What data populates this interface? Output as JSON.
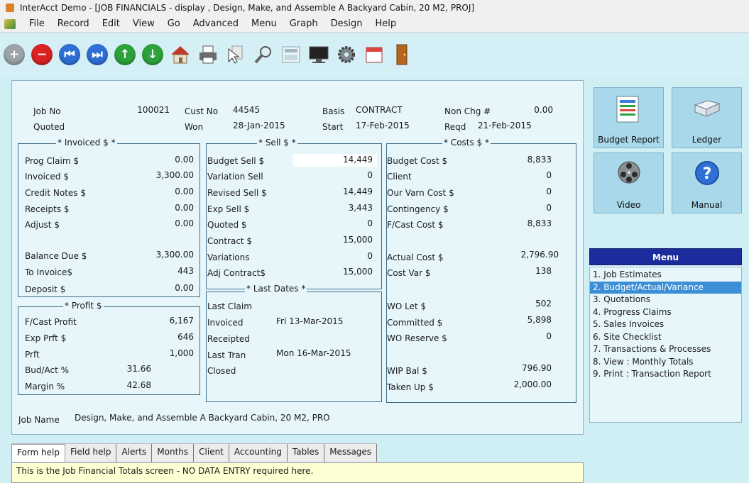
{
  "window": {
    "title": "InterAcct Demo - [JOB FINANCIALS - display , Design, Make, and Assemble A Backyard Cabin, 20 M2, PROJ]"
  },
  "menubar": [
    "File",
    "Record",
    "Edit",
    "View",
    "Go",
    "Advanced",
    "Menu",
    "Graph",
    "Design",
    "Help"
  ],
  "header": {
    "job_no_label": "Job No",
    "job_no": "100021",
    "quoted_label": "Quoted",
    "cust_no_label": "Cust No",
    "cust_no": "44545",
    "won_label": "Won",
    "won": "28-Jan-2015",
    "basis_label": "Basis",
    "basis": "CONTRACT",
    "start_label": "Start",
    "start": "17-Feb-2015",
    "non_chg_label": "Non Chg #",
    "non_chg": "0.00",
    "reqd_label": "Reqd",
    "reqd": "21-Feb-2015"
  },
  "invoiced": {
    "heading": "* Invoiced $ *",
    "prog_claim_label": "Prog Claim $",
    "prog_claim": "0.00",
    "invoiced_label": "Invoiced $",
    "invoiced": "3,300.00",
    "credit_notes_label": "Credit Notes $",
    "credit_notes": "0.00",
    "receipts_label": "Receipts $",
    "receipts": "0.00",
    "adjust_label": "Adjust $",
    "adjust": "0.00",
    "balance_due_label": "Balance Due $",
    "balance_due": "3,300.00",
    "to_invoice_label": "To Invoice$",
    "to_invoice": "443",
    "deposit_label": "Deposit $",
    "deposit": "0.00"
  },
  "profit": {
    "heading": "* Profit $",
    "fcast_profit_label": "F/Cast Profit",
    "fcast_profit": "6,167",
    "exp_prft_label": "Exp Prft $",
    "exp_prft": "646",
    "prft_label": "Prft",
    "prft": "1,000",
    "bud_act_label": "Bud/Act  %",
    "bud_act": "31.66",
    "margin_label": "Margin  %",
    "margin": "42.68"
  },
  "sell": {
    "heading": "* Sell $ *",
    "budget_sell_label": "Budget Sell $",
    "budget_sell": "14,449",
    "variation_sell_label": "Variation Sell",
    "variation_sell": "0",
    "revised_sell_label": "Revised Sell $",
    "revised_sell": "14,449",
    "exp_sell_label": "Exp Sell $",
    "exp_sell": "3,443",
    "quoted_label": "Quoted  $",
    "quoted": "0",
    "contract_label": "Contract $",
    "contract": "15,000",
    "variations_label": "Variations",
    "variations": "0",
    "adj_contract_label": "Adj Contract$",
    "adj_contract": "15,000"
  },
  "last_dates": {
    "heading": "* Last Dates *",
    "last_claim_label": "Last Claim",
    "invoiced_label": "Invoiced",
    "invoiced": "Fri 13-Mar-2015",
    "receipted_label": "Receipted",
    "last_tran_label": "Last Tran",
    "last_tran": "Mon 16-Mar-2015",
    "closed_label": "Closed"
  },
  "costs": {
    "heading": "* Costs $ *",
    "budget_cost_label": "Budget Cost $",
    "budget_cost": "8,833",
    "client_label": "Client",
    "client": "0",
    "our_varn_cost_label": "Our Varn Cost $",
    "our_varn_cost": "0",
    "contingency_label": "Contingency $",
    "contingency": "0",
    "fcast_cost_label": "F/Cast Cost $",
    "fcast_cost": "8,833",
    "actual_cost_label": "Actual Cost $",
    "actual_cost": "2,796.90",
    "cost_var_label": "Cost Var $",
    "cost_var": "138",
    "wo_let_label": "WO Let $",
    "wo_let": "502",
    "committed_label": "Committed $",
    "committed": "5,898",
    "wo_reserve_label": "WO Reserve $",
    "wo_reserve": "0",
    "wip_bal_label": "WIP Bal $",
    "wip_bal": "796.90",
    "taken_up_label": "Taken Up $",
    "taken_up": "2,000.00"
  },
  "job_name_label": "Job Name",
  "job_name": "Design, Make, and Assemble A Backyard Cabin, 20 M2, PRO",
  "tabs": [
    "Form help",
    "Field help",
    "Alerts",
    "Months",
    "Client",
    "Accounting",
    "Tables",
    "Messages"
  ],
  "help_text": "This is the Job Financial Totals screen - NO DATA ENTRY required here.",
  "side_buttons": {
    "budget_report": "Budget Report",
    "ledger": "Ledger",
    "video": "Video",
    "manual": "Manual"
  },
  "menu": {
    "title": "Menu",
    "items": [
      "1. Job Estimates",
      "2. Budget/Actual/Variance",
      "3. Quotations",
      "4. Progress Claims",
      "5. Sales Invoices",
      "6. Site Checklist",
      "7. Transactions & Processes",
      "8. View : Monthly Totals",
      "9. Print : Transaction Report"
    ],
    "selected_index": 1
  }
}
